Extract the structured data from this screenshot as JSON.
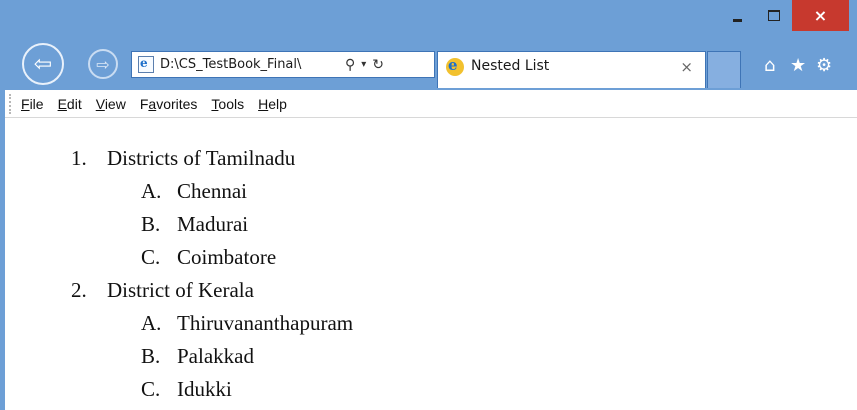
{
  "window": {
    "minimize_label": "",
    "close_label": "×"
  },
  "nav": {
    "address": "D:\\CS_TestBook_Final\\",
    "tab_title": "Nested List",
    "tab_close": "×"
  },
  "menu": [
    "File",
    "Edit",
    "View",
    "Favorites",
    "Tools",
    "Help"
  ],
  "menu_access": [
    "F",
    "E",
    "V",
    "a",
    "T",
    "H"
  ],
  "list": [
    {
      "marker": "1.",
      "label": "Districts of Tamilnadu",
      "children": [
        {
          "marker": "A.",
          "label": "Chennai"
        },
        {
          "marker": "B.",
          "label": "Madurai"
        },
        {
          "marker": "C.",
          "label": "Coimbatore"
        }
      ]
    },
    {
      "marker": "2.",
      "label": "District of Kerala",
      "children": [
        {
          "marker": "A.",
          "label": "Thiruvananthapuram"
        },
        {
          "marker": "B.",
          "label": "Palakkad"
        },
        {
          "marker": "C.",
          "label": "Idukki"
        }
      ]
    }
  ]
}
